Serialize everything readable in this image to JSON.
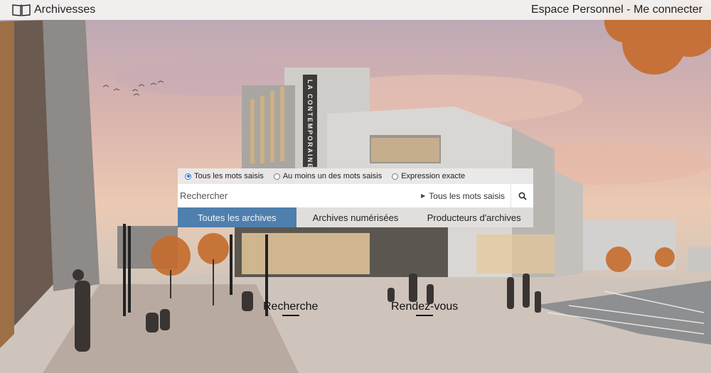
{
  "header": {
    "brand": "Archivesses",
    "account_link": "Espace Personnel - Me connecter"
  },
  "search": {
    "modes": [
      {
        "label": "Tous les mots saisis",
        "selected": true
      },
      {
        "label": "Au moins un des mots saisis",
        "selected": false
      },
      {
        "label": "Expression exacte",
        "selected": false
      }
    ],
    "placeholder": "Rechercher",
    "scope_label": "Tous les mots saisis",
    "tabs": [
      {
        "label": "Toutes les archives",
        "active": true
      },
      {
        "label": "Archives numérisées",
        "active": false
      },
      {
        "label": "Producteurs d'archives",
        "active": false
      }
    ]
  },
  "quick_links": {
    "search": "Recherche",
    "appointments": "Rendez-vous"
  },
  "building_sign": "LA CONTEMPORAINE",
  "colors": {
    "active_tab": "#4f7fad",
    "radio_selected": "#2f74d0"
  },
  "icons": {
    "brand": "open-book-icon",
    "search": "magnifier-icon",
    "scope": "caret-right-icon"
  }
}
